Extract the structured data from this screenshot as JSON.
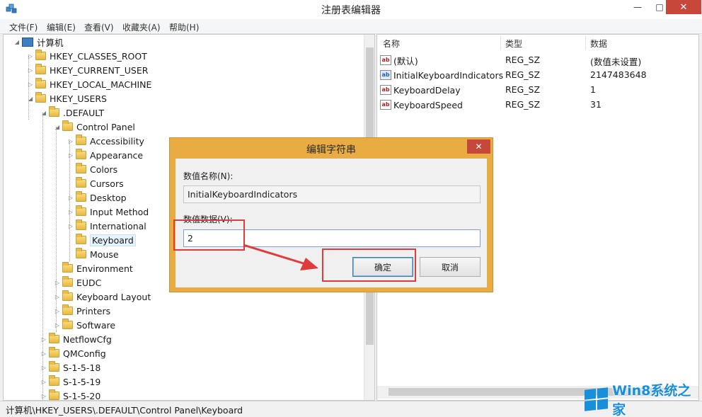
{
  "window": {
    "title": "注册表编辑器",
    "min": "—",
    "max": "□",
    "close": "✕"
  },
  "menu": [
    "文件(F)",
    "编辑(E)",
    "查看(V)",
    "收藏夹(A)",
    "帮助(H)"
  ],
  "tree": {
    "root": "计算机",
    "hkcr": "HKEY_CLASSES_ROOT",
    "hkcu": "HKEY_CURRENT_USER",
    "hklm": "HKEY_LOCAL_MACHINE",
    "hku": "HKEY_USERS",
    "default": ".DEFAULT",
    "control_panel": "Control Panel",
    "cp_children": [
      "Accessibility",
      "Appearance",
      "Colors",
      "Cursors",
      "Desktop",
      "Input Method",
      "International",
      "Keyboard",
      "Mouse"
    ],
    "default_children": [
      "Environment",
      "EUDC",
      "Keyboard Layout",
      "Printers",
      "Software"
    ],
    "users_children": [
      "NetflowCfg",
      "QMConfig",
      "S-1-5-18",
      "S-1-5-19",
      "S-1-5-20"
    ]
  },
  "list": {
    "headers": {
      "name": "名称",
      "type": "类型",
      "data": "数据"
    },
    "rows": [
      {
        "name": "(默认)",
        "type": "REG_SZ",
        "data": "(数值未设置)"
      },
      {
        "name": "InitialKeyboardIndicators",
        "type": "REG_SZ",
        "data": "2147483648"
      },
      {
        "name": "KeyboardDelay",
        "type": "REG_SZ",
        "data": "1"
      },
      {
        "name": "KeyboardSpeed",
        "type": "REG_SZ",
        "data": "31"
      }
    ]
  },
  "status": "计算机\\HKEY_USERS\\.DEFAULT\\Control Panel\\Keyboard",
  "dialog": {
    "title": "编辑字符串",
    "close": "✕",
    "name_label": "数值名称(N):",
    "name_value": "InitialKeyboardIndicators",
    "data_label": "数值数据(V):",
    "data_value": "2",
    "ok": "确定",
    "cancel": "取消"
  },
  "watermark": "Win8系统之家",
  "colors": {
    "highlight": "#e03a3a",
    "dialog_frame": "#e8ac42",
    "close": "#c7483b"
  }
}
